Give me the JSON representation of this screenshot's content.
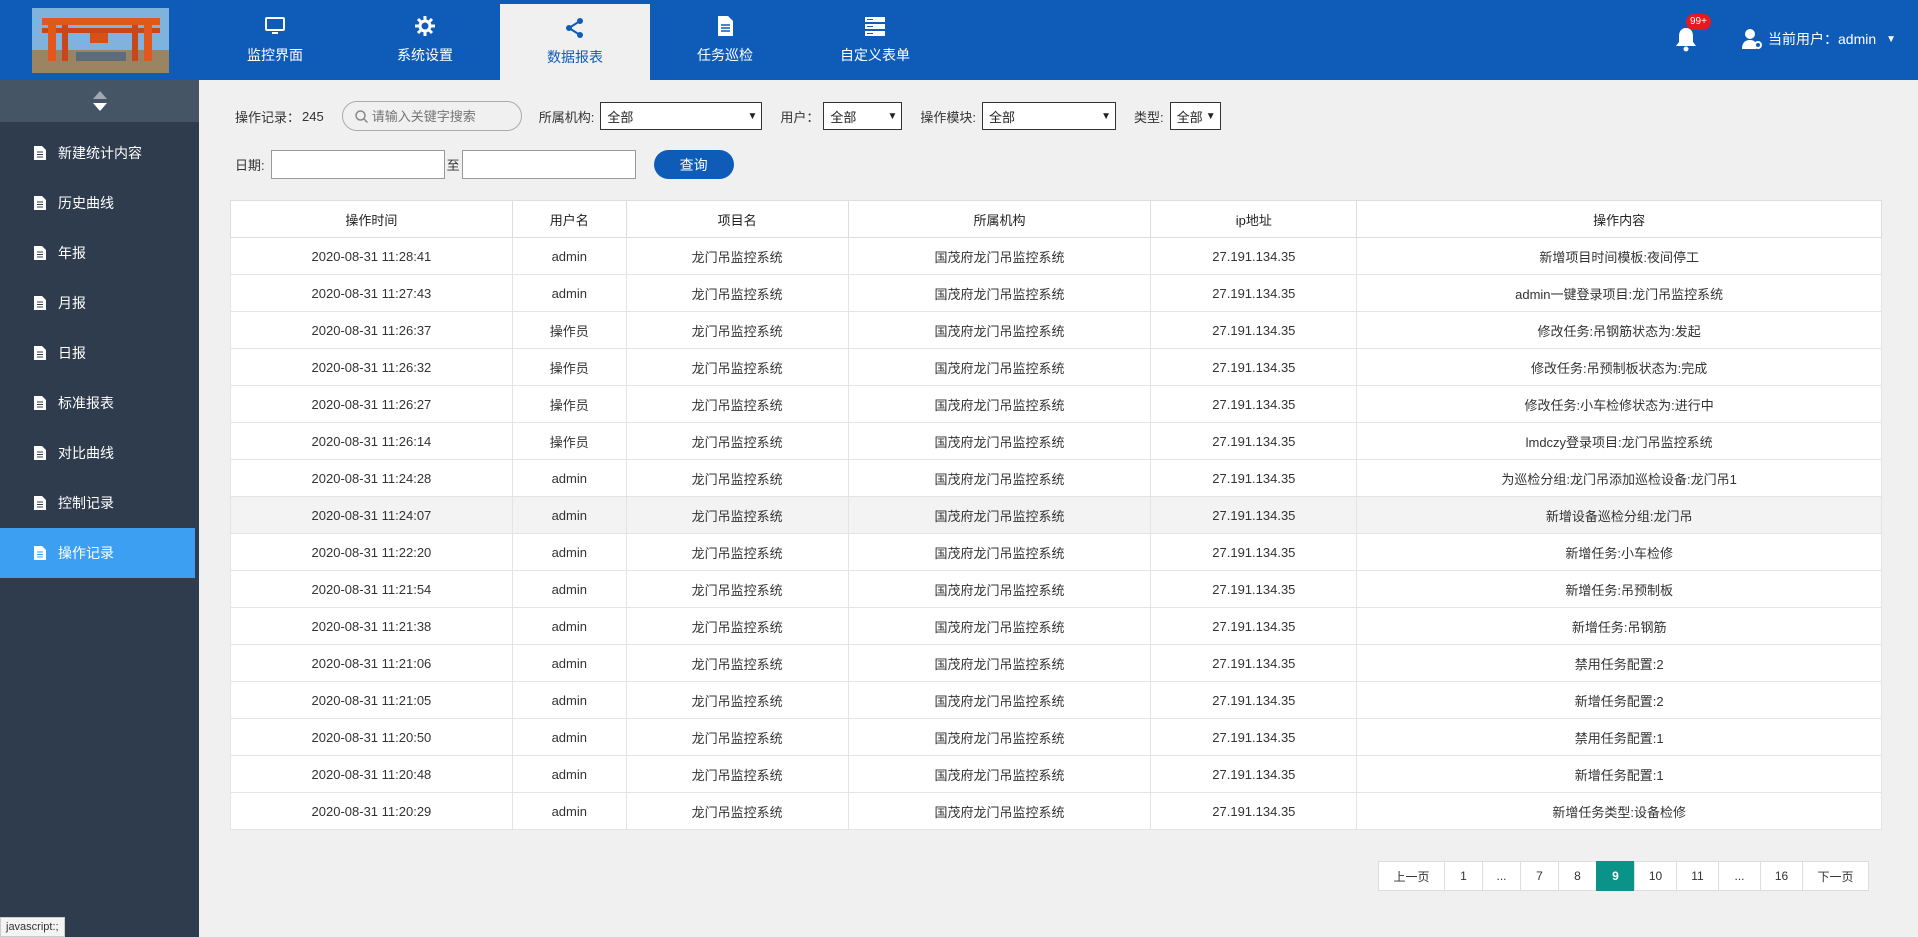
{
  "nav": [
    {
      "label": "监控界面",
      "icon": "monitor-icon"
    },
    {
      "label": "系统设置",
      "icon": "gear-icon"
    },
    {
      "label": "数据报表",
      "icon": "share-icon"
    },
    {
      "label": "任务巡检",
      "icon": "document-icon"
    },
    {
      "label": "自定义表单",
      "icon": "server-icon"
    }
  ],
  "header": {
    "badge": "99+",
    "user_label": "当前用户：admin"
  },
  "sidebar": {
    "items": [
      "新建统计内容",
      "历史曲线",
      "年报",
      "月报",
      "日报",
      "标准报表",
      "对比曲线",
      "控制记录",
      "操作记录"
    ]
  },
  "filters": {
    "record_label": "操作记录：",
    "record_count": "245",
    "search_placeholder": "请输入关键字搜索",
    "org_label": "所属机构:",
    "org_value": "全部",
    "user_label": "用户：",
    "user_value": "全部",
    "module_label": "操作模块:",
    "module_value": "全部",
    "type_label": "类型:",
    "type_value": "全部",
    "date_label": "日期:",
    "date_to": "至",
    "query_label": "查询"
  },
  "table": {
    "headers": [
      "操作时间",
      "用户名",
      "项目名",
      "所属机构",
      "ip地址",
      "操作内容"
    ],
    "rows": [
      [
        "2020-08-31 11:28:41",
        "admin",
        "龙门吊监控系统",
        "国茂府龙门吊监控系统",
        "27.191.134.35",
        "新增项目时间模板:夜间停工"
      ],
      [
        "2020-08-31 11:27:43",
        "admin",
        "龙门吊监控系统",
        "国茂府龙门吊监控系统",
        "27.191.134.35",
        "admin一键登录项目:龙门吊监控系统"
      ],
      [
        "2020-08-31 11:26:37",
        "操作员",
        "龙门吊监控系统",
        "国茂府龙门吊监控系统",
        "27.191.134.35",
        "修改任务:吊钢筋状态为:发起"
      ],
      [
        "2020-08-31 11:26:32",
        "操作员",
        "龙门吊监控系统",
        "国茂府龙门吊监控系统",
        "27.191.134.35",
        "修改任务:吊预制板状态为:完成"
      ],
      [
        "2020-08-31 11:26:27",
        "操作员",
        "龙门吊监控系统",
        "国茂府龙门吊监控系统",
        "27.191.134.35",
        "修改任务:小车检修状态为:进行中"
      ],
      [
        "2020-08-31 11:26:14",
        "操作员",
        "龙门吊监控系统",
        "国茂府龙门吊监控系统",
        "27.191.134.35",
        "lmdczy登录项目:龙门吊监控系统"
      ],
      [
        "2020-08-31 11:24:28",
        "admin",
        "龙门吊监控系统",
        "国茂府龙门吊监控系统",
        "27.191.134.35",
        "为巡检分组:龙门吊添加巡检设备:龙门吊1"
      ],
      [
        "2020-08-31 11:24:07",
        "admin",
        "龙门吊监控系统",
        "国茂府龙门吊监控系统",
        "27.191.134.35",
        "新增设备巡检分组:龙门吊"
      ],
      [
        "2020-08-31 11:22:20",
        "admin",
        "龙门吊监控系统",
        "国茂府龙门吊监控系统",
        "27.191.134.35",
        "新增任务:小车检修"
      ],
      [
        "2020-08-31 11:21:54",
        "admin",
        "龙门吊监控系统",
        "国茂府龙门吊监控系统",
        "27.191.134.35",
        "新增任务:吊预制板"
      ],
      [
        "2020-08-31 11:21:38",
        "admin",
        "龙门吊监控系统",
        "国茂府龙门吊监控系统",
        "27.191.134.35",
        "新增任务:吊钢筋"
      ],
      [
        "2020-08-31 11:21:06",
        "admin",
        "龙门吊监控系统",
        "国茂府龙门吊监控系统",
        "27.191.134.35",
        "禁用任务配置:2"
      ],
      [
        "2020-08-31 11:21:05",
        "admin",
        "龙门吊监控系统",
        "国茂府龙门吊监控系统",
        "27.191.134.35",
        "新增任务配置:2"
      ],
      [
        "2020-08-31 11:20:50",
        "admin",
        "龙门吊监控系统",
        "国茂府龙门吊监控系统",
        "27.191.134.35",
        "禁用任务配置:1"
      ],
      [
        "2020-08-31 11:20:48",
        "admin",
        "龙门吊监控系统",
        "国茂府龙门吊监控系统",
        "27.191.134.35",
        "新增任务配置:1"
      ],
      [
        "2020-08-31 11:20:29",
        "admin",
        "龙门吊监控系统",
        "国茂府龙门吊监控系统",
        "27.191.134.35",
        "新增任务类型:设备检修"
      ]
    ]
  },
  "pagination": {
    "prev": "上一页",
    "next": "下一页",
    "pages": [
      "1",
      "...",
      "7",
      "8",
      "9",
      "10",
      "11",
      "...",
      "16"
    ],
    "current": "9"
  },
  "status_bar": "javascript:;",
  "colors": {
    "brand": "#0e5cb8",
    "sidebar": "#2f3c4e",
    "sidebar_active": "#3d9ff2",
    "page_active": "#0a9388"
  }
}
